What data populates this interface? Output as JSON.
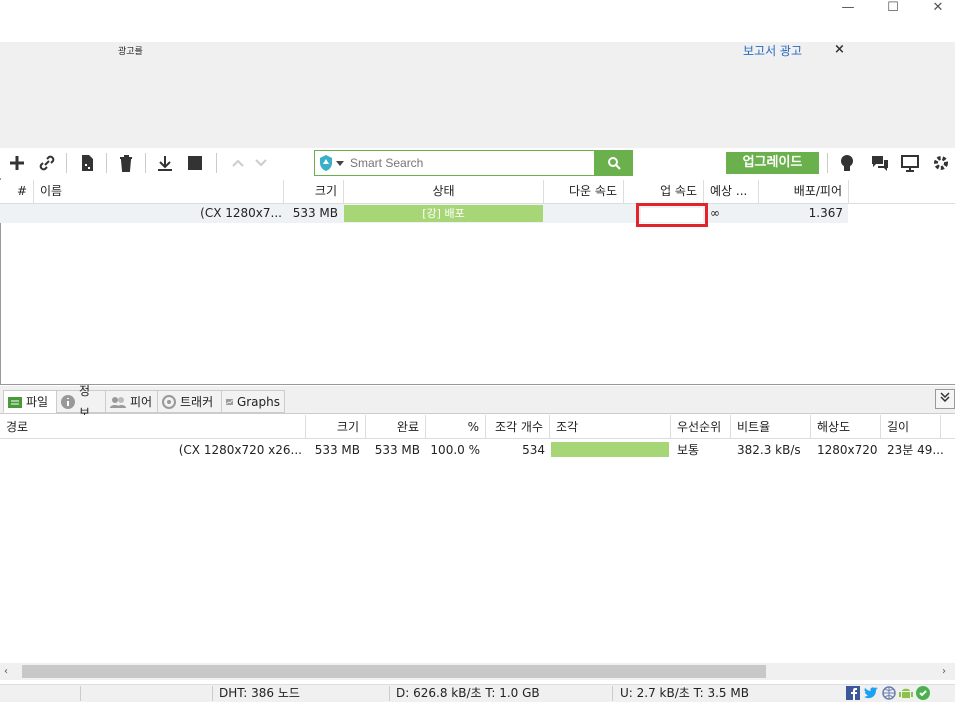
{
  "window": {
    "controls": [
      "—",
      "☐",
      "✕"
    ]
  },
  "ad": {
    "label": "광고를",
    "report_link": "보고서 광고",
    "close": "×"
  },
  "toolbar": {
    "search_placeholder": "Smart Search",
    "upgrade_label": "업그레이드"
  },
  "torrents": {
    "columns": [
      "#",
      "이름",
      "크기",
      "상태",
      "다운 속도",
      "업 속도",
      "예상 ...",
      "배포/피어"
    ],
    "rows": [
      {
        "name": "(CX 1280x7...",
        "size": "533 MB",
        "status": "[강] 배포",
        "down": "",
        "up": "",
        "eta": "∞",
        "ratio": "1.367"
      }
    ]
  },
  "tabs": {
    "files": "파일",
    "info": "정보",
    "peers": "피어",
    "trackers": "트래커",
    "graphs": "Graphs"
  },
  "files": {
    "columns": [
      "경로",
      "크기",
      "완료",
      "%",
      "조각 개수",
      "조각",
      "우선순위",
      "비트율",
      "해상도",
      "길이"
    ],
    "rows": [
      {
        "path": "(CX 1280x720 x26...",
        "size": "533 MB",
        "done": "533 MB",
        "pct": "100.0 %",
        "pieces_count": "534",
        "priority": "보통",
        "bitrate": "382.3 kB/s",
        "resolution": "1280x720",
        "length": "23분 49..."
      }
    ]
  },
  "statusbar": {
    "dht": "DHT: 386 노드",
    "down": "D: 626.8 kB/초 T: 1.0 GB",
    "up": "U: 2.7 kB/초 T: 3.5 MB"
  },
  "colors": {
    "accent": "#6ab04c",
    "status_fill": "#a6d676",
    "highlight": "#e0242a"
  }
}
